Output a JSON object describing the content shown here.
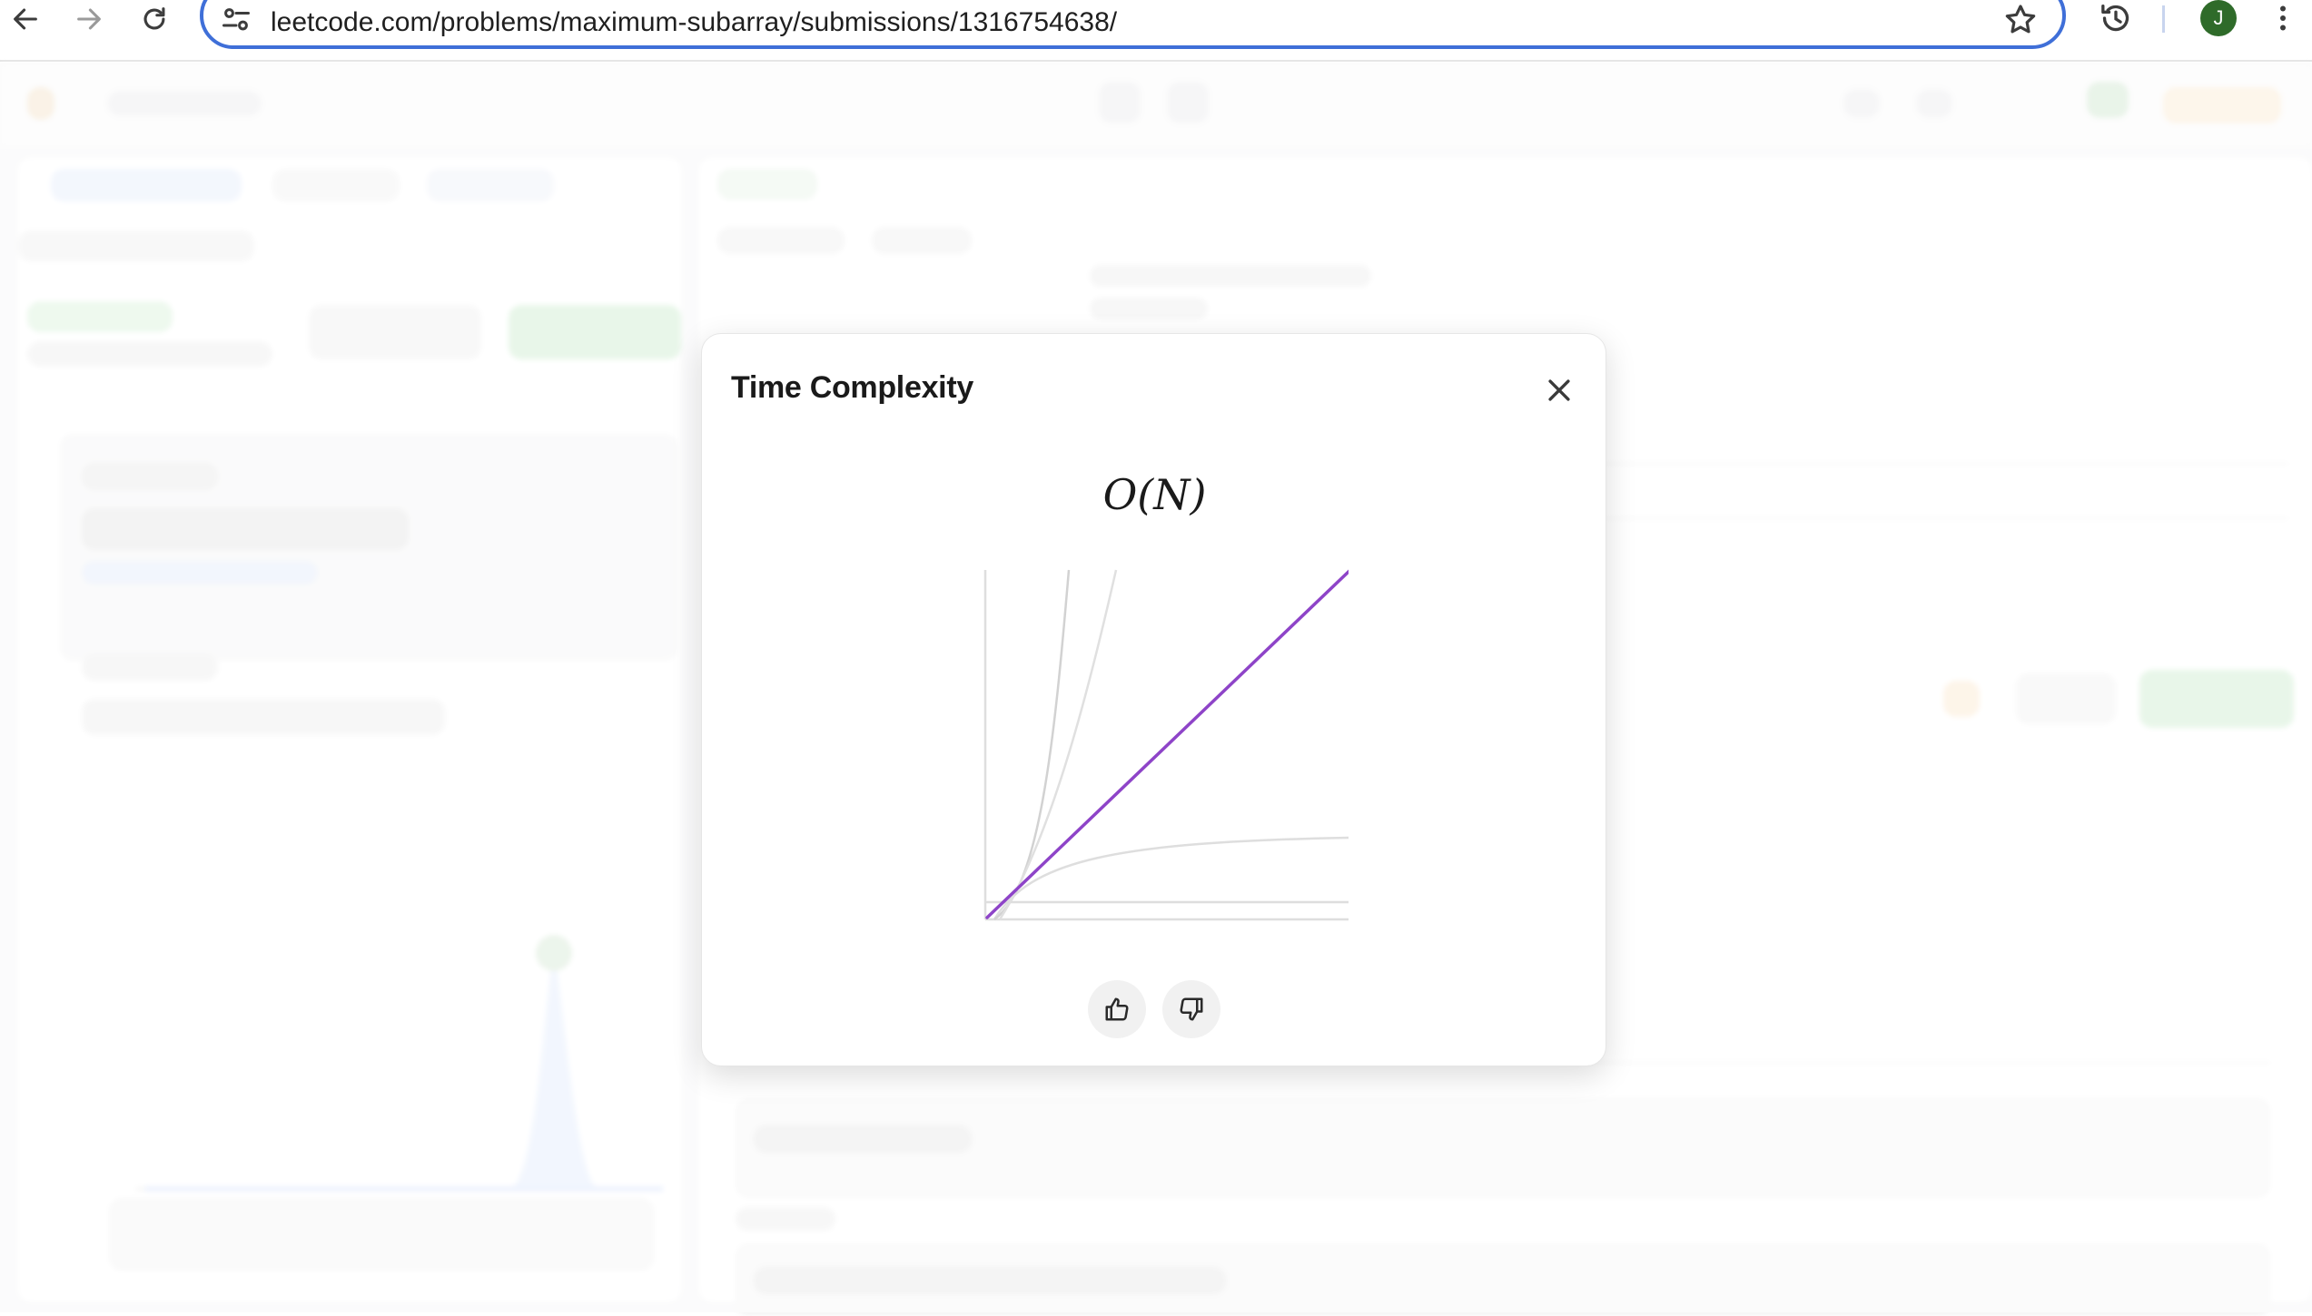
{
  "browser": {
    "url": "leetcode.com/problems/maximum-subarray/submissions/1316754638/",
    "profile_initial": "J"
  },
  "modal": {
    "title": "Time Complexity",
    "complexity": "O(N)",
    "accent_color": "#8e44c8"
  }
}
